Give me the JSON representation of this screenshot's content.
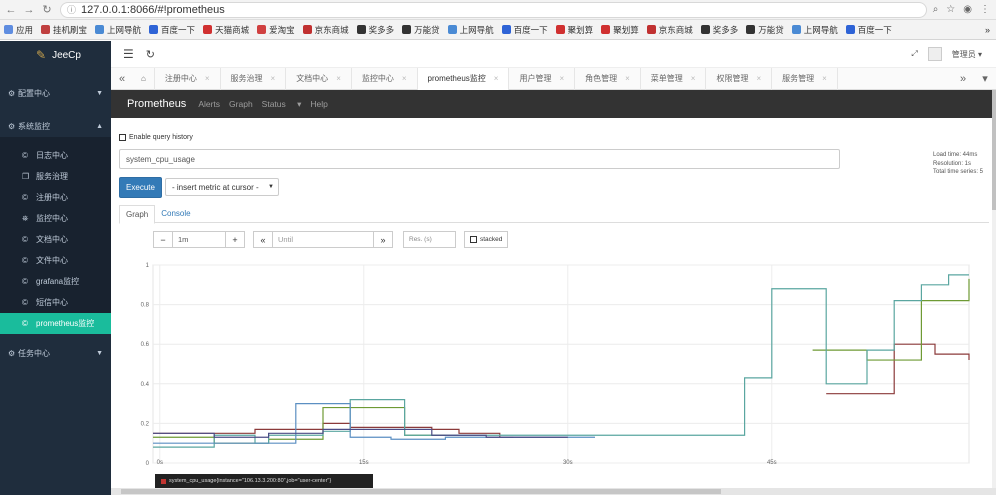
{
  "browser": {
    "url": "127.0.0.1:8066/#!prometheus",
    "bookmarks": [
      "应用",
      "挂机刷宝",
      "上网导航",
      "百度一下",
      "天猫商城",
      "爱淘宝",
      "京东商城",
      "奖多多",
      "万能贷",
      "上网导航",
      "百度一下",
      "聚划算",
      "聚划算",
      "京东商城",
      "奖多多",
      "万能贷",
      "上网导航",
      "百度一下"
    ],
    "more": "»"
  },
  "sidebar": {
    "logo": "JeeCp",
    "groups": [
      {
        "label": "配置中心",
        "expanded": false
      },
      {
        "label": "系统监控",
        "expanded": true,
        "items": [
          "日志中心",
          "服务治理",
          "注册中心",
          "监控中心",
          "文档中心",
          "文件中心",
          "grafana监控",
          "短信中心",
          "prometheus监控"
        ],
        "active": "prometheus监控"
      },
      {
        "label": "任务中心",
        "expanded": false
      }
    ]
  },
  "topbar": {
    "user": "管理员"
  },
  "tabs": [
    "注册中心",
    "服务治理",
    "文档中心",
    "监控中心",
    "prometheus监控",
    "用户管理",
    "角色管理",
    "菜单管理",
    "权限管理",
    "服务管理"
  ],
  "active_tab": "prometheus监控",
  "prometheus": {
    "brand": "Prometheus",
    "nav": [
      "Alerts",
      "Graph",
      "Status",
      "Help"
    ],
    "enable_history": "Enable query history",
    "expression": "system_cpu_usage",
    "load_time": "Load time: 44ms",
    "resolution": "Resolution: 1s",
    "total_series": "Total time series: 5",
    "execute": "Execute",
    "insert_metric": "- insert metric at cursor -",
    "subtabs": [
      "Graph",
      "Console"
    ],
    "range": "1m",
    "until_placeholder": "Until",
    "res_placeholder": "Res. (s)",
    "stacked": "stacked",
    "tooltip": "system_cpu_usage{instance=\"106.13.3.200:80\",job=\"user-center\"}"
  },
  "chart_data": {
    "type": "line",
    "y_ticks": [
      "0",
      "0.2",
      "0.4",
      "0.6",
      "0.8",
      "1"
    ],
    "x_ticks": [
      "0s",
      "15s",
      "30s",
      "45s"
    ],
    "ylim": [
      0,
      1
    ],
    "xlim": [
      -0.5,
      59.5
    ],
    "grid": true,
    "colors": {
      "s1": "#8b3a3a",
      "s2": "#6e9a34",
      "s3": "#5aa6a0",
      "s4": "#5b8fc2",
      "s5": "#4b4b85"
    },
    "series": [
      {
        "key": "s1",
        "x": [
          -0.5,
          3,
          5,
          7,
          10,
          12,
          14,
          20,
          22,
          25,
          26,
          36,
          40,
          42,
          44,
          46,
          49,
          52,
          54,
          55,
          56,
          57,
          59,
          59.5
        ],
        "y": [
          0.15,
          0.15,
          0.15,
          0.17,
          0.17,
          0.2,
          0.18,
          0.17,
          0.15,
          0.13,
          0.13,
          null,
          null,
          null,
          null,
          null,
          0.35,
          0.35,
          0.6,
          0.6,
          0.6,
          0.55,
          0.55,
          0.52
        ]
      },
      {
        "key": "s2",
        "x": [
          -0.5,
          4,
          6,
          8,
          10,
          12,
          14,
          16,
          18,
          20,
          21,
          36,
          40,
          44,
          46,
          48,
          50,
          52,
          54,
          56,
          58,
          59.5
        ],
        "y": [
          0.13,
          0.1,
          0.1,
          0.12,
          0.12,
          0.28,
          0.28,
          0.28,
          0.14,
          0.14,
          0.14,
          null,
          null,
          null,
          null,
          0.57,
          0.57,
          0.52,
          0.52,
          0.82,
          0.82,
          0.93
        ]
      },
      {
        "key": "s3",
        "x": [
          -0.5,
          2,
          4,
          6,
          7,
          8,
          10,
          12,
          14,
          15,
          16,
          18,
          20,
          22,
          24,
          26,
          28,
          32,
          36,
          40,
          43,
          44,
          45,
          46,
          48,
          49,
          50,
          51,
          52,
          53,
          54,
          55,
          56,
          57,
          58,
          59.5
        ],
        "y": [
          0.08,
          0.08,
          0.14,
          0.14,
          0.1,
          0.14,
          0.14,
          0.16,
          0.32,
          0.32,
          0.32,
          0.14,
          0.14,
          0.14,
          0.14,
          0.14,
          0.14,
          0.14,
          0.14,
          0.14,
          0.43,
          0.43,
          0.88,
          0.88,
          0.88,
          0.4,
          0.4,
          0.4,
          0.57,
          0.57,
          0.82,
          0.82,
          0.9,
          0.9,
          0.95,
          0.95
        ]
      },
      {
        "key": "s4",
        "x": [
          -0.5,
          1,
          3,
          5,
          7,
          9,
          10,
          11,
          12,
          13,
          14,
          15,
          16,
          17,
          18,
          19,
          20,
          21,
          22,
          24,
          26,
          28,
          30,
          32
        ],
        "y": [
          0.1,
          0.1,
          0.1,
          0.1,
          0.1,
          0.1,
          0.3,
          0.3,
          0.3,
          0.3,
          0.13,
          0.13,
          0.13,
          0.12,
          0.12,
          0.12,
          0.12,
          0.13,
          0.13,
          0.13,
          0.13,
          0.13,
          0.13,
          0.13
        ]
      },
      {
        "key": "s5",
        "x": [
          -0.5,
          2,
          4,
          6,
          8,
          10,
          12,
          14,
          16,
          18,
          20,
          22,
          24,
          26,
          28,
          30
        ],
        "y": [
          0.15,
          0.15,
          0.13,
          0.13,
          0.15,
          0.15,
          0.17,
          0.17,
          0.17,
          0.17,
          0.14,
          0.14,
          0.13,
          0.13,
          0.13,
          0.13
        ]
      }
    ]
  }
}
